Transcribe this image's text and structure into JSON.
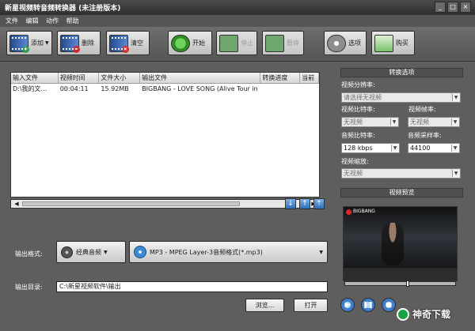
{
  "window": {
    "title": "新星视频转音频转换器 (未注册版本)",
    "controls": [
      "_",
      "□",
      "×"
    ]
  },
  "menu": [
    "文件",
    "编辑",
    "动作",
    "帮助"
  ],
  "toolbar": {
    "add": "添加",
    "delete": "删除",
    "clear": "清空",
    "start": "开始",
    "stop": "停止",
    "pause": "暂停",
    "options": "选项",
    "buy": "购买"
  },
  "table": {
    "columns": [
      "输入文件",
      "视频时间",
      "文件大小",
      "输出文件",
      "转换进度",
      "当前"
    ],
    "rows": [
      [
        "D:\\我的文...",
        "00:04:11",
        "15.92MB",
        "BIGBANG - LOVE SONG (Alive Tour in ...",
        "",
        ""
      ]
    ]
  },
  "output": {
    "format_label": "输出格式:",
    "category": "经典音频",
    "format": "MP3 - MPEG Layer-3音频格式(*.mp3)",
    "dir_label": "输出目录:",
    "dir_value": "C:\\新星视频软件\\输出",
    "browse": "浏览...",
    "open": "打开"
  },
  "settings": {
    "section_title": "转换选项",
    "video_resolution_label": "视频分辨率:",
    "video_resolution_value": "请选择无视频",
    "video_bitrate_label": "视频比特率:",
    "video_bitrate_value": "无视频",
    "video_framerate_label": "视频帧率:",
    "video_framerate_value": "无视频",
    "audio_bitrate_label": "音频比特率:",
    "audio_bitrate_value": "128 kbps",
    "audio_sample_rate_label": "音频采样率:",
    "audio_sample_rate_value": "44100",
    "video_scale_label": "视频缩放:",
    "video_scale_value": "无视频"
  },
  "preview": {
    "section_title": "视频预览",
    "progress_fraction": 0.57,
    "overlay_text": "BIGBANG"
  },
  "logo": {
    "text": "神奇下载"
  }
}
